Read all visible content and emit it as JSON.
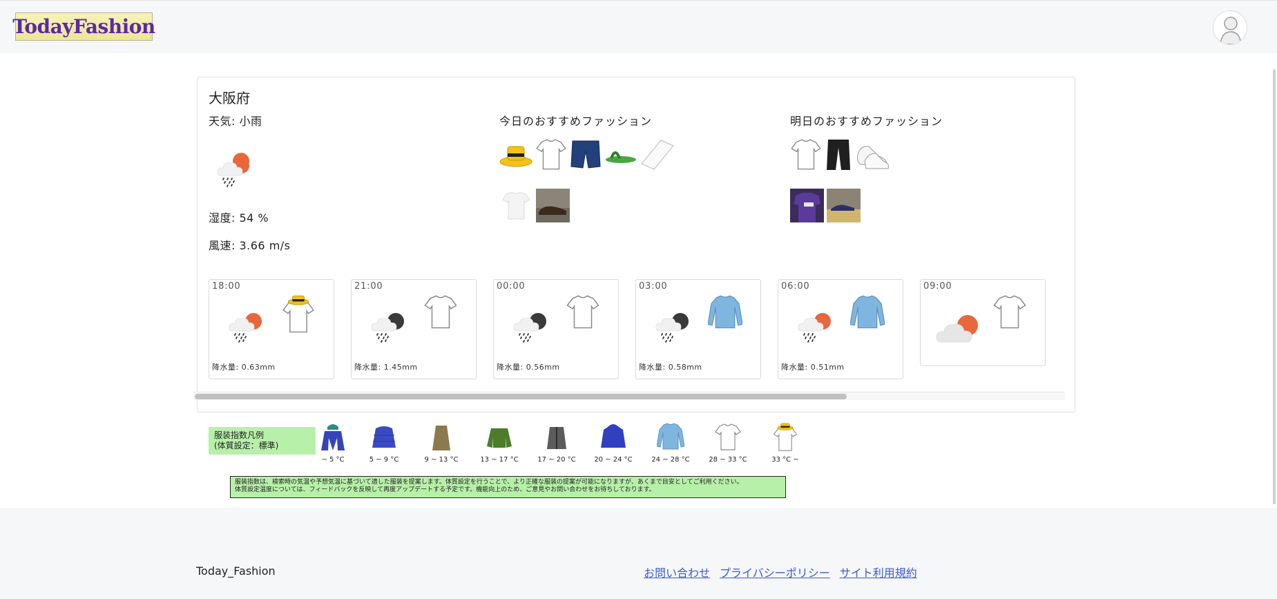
{
  "header": {
    "logo_text": "TodayFashion"
  },
  "location": {
    "prefecture": "大阪府"
  },
  "current": {
    "weather": "天気: 小雨",
    "humidity": "湿度: 54 %",
    "wind": "風速: 3.66 m/s"
  },
  "today": {
    "title": "今日のおすすめファッション"
  },
  "tomorrow": {
    "title": "明日のおすすめファッション"
  },
  "forecast": [
    {
      "time": "18:00",
      "rain": "降水量: 0.63mm",
      "weather_icon": "rain-sun-icon",
      "clothing_icon": "tshirt-hat-icon"
    },
    {
      "time": "21:00",
      "rain": "降水量: 1.45mm",
      "weather_icon": "rain-moon-icon",
      "clothing_icon": "tshirt-icon"
    },
    {
      "time": "00:00",
      "rain": "降水量: 0.56mm",
      "weather_icon": "rain-moon-icon",
      "clothing_icon": "tshirt-icon"
    },
    {
      "time": "03:00",
      "rain": "降水量: 0.58mm",
      "weather_icon": "rain-moon-icon",
      "clothing_icon": "longsleeve-icon"
    },
    {
      "time": "06:00",
      "rain": "降水量: 0.51mm",
      "weather_icon": "rain-sun-icon",
      "clothing_icon": "longsleeve-icon"
    },
    {
      "time": "09:00",
      "rain": "",
      "weather_icon": "cloud-sun-icon",
      "clothing_icon": "tshirt-icon"
    }
  ],
  "legend": {
    "label_line1": "服装指数凡例",
    "label_line2": "(体質設定：標準)",
    "items": [
      {
        "range": "~ 5 °C",
        "icon": "down-jacket-hat-icon"
      },
      {
        "range": "5 ~ 9 °C",
        "icon": "down-jacket-icon"
      },
      {
        "range": "9 ~ 13 °C",
        "icon": "coat-icon"
      },
      {
        "range": "13 ~ 17 °C",
        "icon": "bomber-jacket-icon"
      },
      {
        "range": "17 ~ 20 °C",
        "icon": "cardigan-icon"
      },
      {
        "range": "20 ~ 24 °C",
        "icon": "hoodie-icon"
      },
      {
        "range": "24 ~ 28 °C",
        "icon": "longsleeve-icon"
      },
      {
        "range": "28 ~ 33 °C",
        "icon": "tshirt-icon"
      },
      {
        "range": "33 °C ~",
        "icon": "tshirt-hat-icon"
      }
    ],
    "note_line1": "服装指数は、検索時の気温や予想気温に基づいて適した服装を提案します。体質設定を行うことで、より正確な服装の提案が可能になりますが、あくまで目安としてご利用ください。",
    "note_line2": "体質設定温度については、フィードバックを反映して再度アップデートする予定です。機能向上のため、ご意見やお問い合わせをお待ちしております。"
  },
  "footer": {
    "brand": "Today_Fashion",
    "links": [
      "お問い合わせ",
      "プライバシーポリシー",
      "サイト利用規約"
    ]
  },
  "colors": {
    "legend_bg": "#b7f0a8",
    "link": "#3b5bd6",
    "logo_text": "#5a2aa6",
    "sun": "#e8673c"
  }
}
